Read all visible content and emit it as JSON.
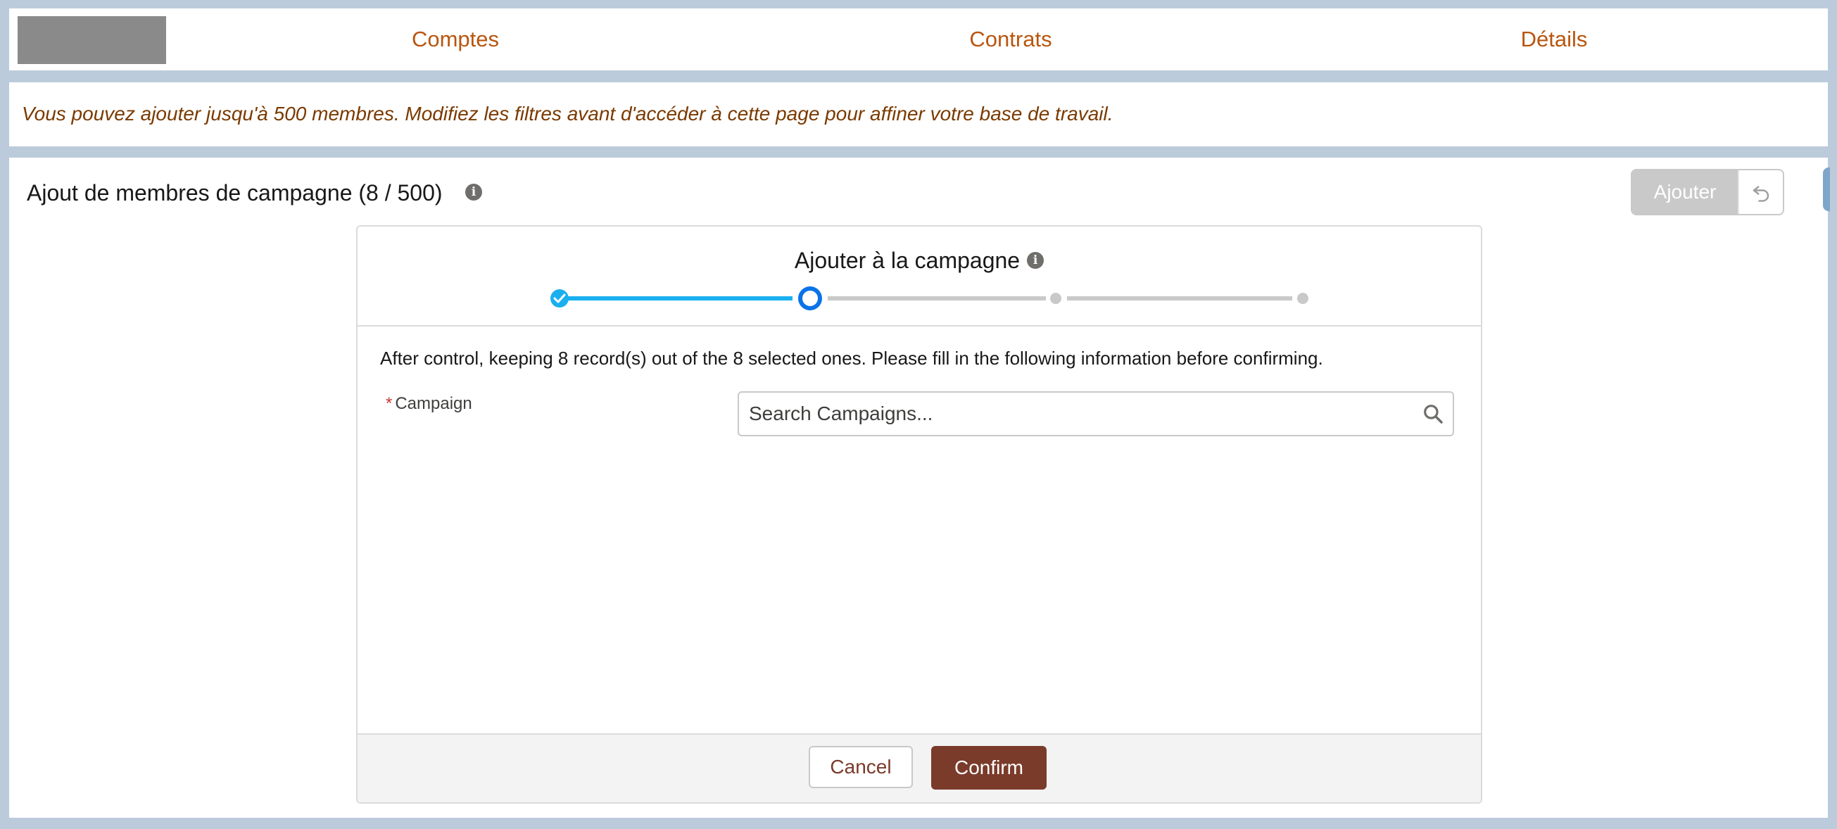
{
  "nav": {
    "links": [
      "Comptes",
      "Contrats",
      "Détails"
    ]
  },
  "banner": {
    "text": "Vous pouvez ajouter jusqu'à 500 membres. Modifiez les filtres avant d'accéder à cette page pour affiner votre base de travail."
  },
  "page": {
    "title": "Ajout de membres de campagne (8 / 500)",
    "add_button": "Ajouter"
  },
  "wizard": {
    "title": "Ajouter à la campagne",
    "current_step": 2,
    "total_steps": 4,
    "description": "After control, keeping 8 record(s) out of the 8 selected ones. Please fill in the following information before confirming.",
    "field_label": "Campaign",
    "required_marker": "*",
    "search_placeholder": "Search Campaigns...",
    "cancel_label": "Cancel",
    "confirm_label": "Confirm"
  },
  "colors": {
    "nav_link": "#b8560f",
    "banner_text": "#7a3a00",
    "progress_active": "#1ab0f0",
    "progress_current": "#0b73e8",
    "progress_inactive": "#c9c9c9",
    "confirm_button": "#7a3b2b",
    "page_background": "#bccbdc"
  }
}
